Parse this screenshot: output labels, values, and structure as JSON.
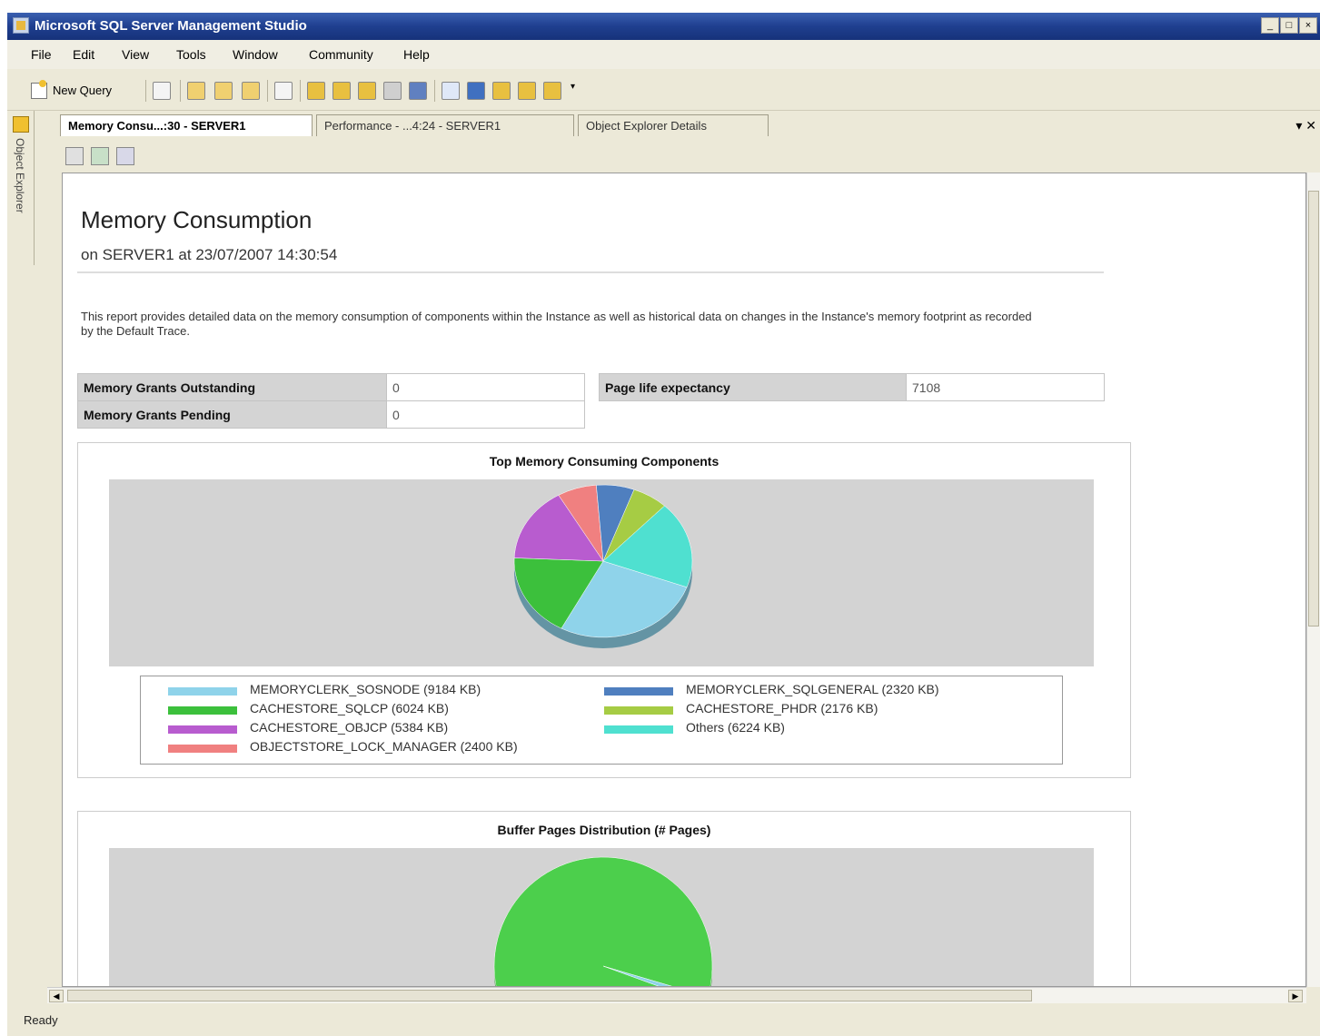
{
  "window": {
    "title": "Microsoft SQL Server Management Studio"
  },
  "menu": [
    "File",
    "Edit",
    "View",
    "Tools",
    "Window",
    "Community",
    "Help"
  ],
  "toolbar": {
    "new_query_label": "New Query"
  },
  "side_panel": {
    "label": "Object Explorer"
  },
  "tabs": [
    {
      "label": "Memory Consu...:30 - SERVER1",
      "active": true
    },
    {
      "label": "Performance - ...4:24 - SERVER1",
      "active": false
    },
    {
      "label": "Object Explorer Details",
      "active": false
    }
  ],
  "tab_controls": "▾ ✕",
  "report": {
    "title": "Memory Consumption",
    "subtitle": "on SERVER1 at 23/07/2007 14:30:54",
    "description": "This report provides detailed data on the memory consumption of components within the Instance as well as historical data on changes in the Instance's memory footprint as recorded by the Default Trace."
  },
  "stats_left": [
    {
      "key": "Memory Grants Outstanding",
      "value": "0"
    },
    {
      "key": "Memory Grants Pending",
      "value": "0"
    }
  ],
  "stats_right": [
    {
      "key": "Page life expectancy",
      "value": "7108"
    }
  ],
  "chart_data": [
    {
      "type": "pie",
      "title": "Top Memory Consuming Components",
      "series": [
        {
          "name": "MEMORYCLERK_SOSNODE (9184 KB)",
          "value": 9184,
          "color": "#8fd3ea"
        },
        {
          "name": "CACHESTORE_SQLCP (6024 KB)",
          "value": 6024,
          "color": "#3cc03c"
        },
        {
          "name": "CACHESTORE_OBJCP (5384 KB)",
          "value": 5384,
          "color": "#b85ccf"
        },
        {
          "name": "OBJECTSTORE_LOCK_MANAGER (2400 KB)",
          "value": 2400,
          "color": "#f08080"
        },
        {
          "name": "MEMORYCLERK_SQLGENERAL (2320 KB)",
          "value": 2320,
          "color": "#4f7fbf"
        },
        {
          "name": "CACHESTORE_PHDR (2176 KB)",
          "value": 2176,
          "color": "#a6cc44"
        },
        {
          "name": "Others (6224 KB)",
          "value": 6224,
          "color": "#4fe0d0"
        }
      ]
    },
    {
      "type": "pie",
      "title": "Buffer Pages Distribution (# Pages)",
      "series": [
        {
          "name": "",
          "value": 99,
          "color": "#4ccf4c"
        },
        {
          "name": "",
          "value": 1,
          "color": "#8fd3ea"
        }
      ]
    }
  ],
  "status": "Ready"
}
